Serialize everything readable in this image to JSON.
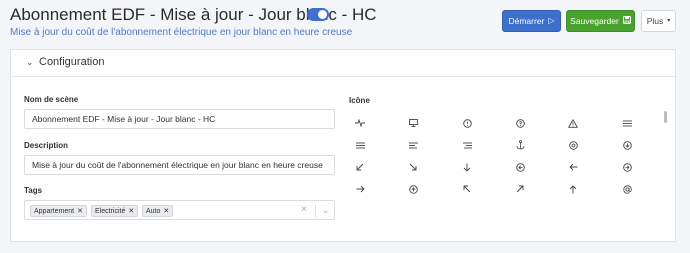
{
  "header": {
    "title": "Abonnement EDF - Mise à jour - Jour blanc - HC",
    "subtitle": "Mise à jour du coût de l'abonnement électrique en jour blanc en heure creuse",
    "toggle_on": true,
    "start_label": "Démarrer",
    "save_label": "Sauvegarder",
    "more_label": "Plus"
  },
  "colors": {
    "primary": "#3d6fcd",
    "success": "#4aa22e",
    "subtitle": "#4f7cc8"
  },
  "card": {
    "title": "Configuration",
    "name_label": "Nom de scène",
    "name_value": "Abonnement EDF - Mise à jour - Jour blanc - HC",
    "description_label": "Description",
    "description_value": "Mise à jour du coût de l'abonnement électrique en jour blanc en heure creuse",
    "tags_label": "Tags",
    "tags": [
      "Appartement",
      "Electricité",
      "Auto"
    ],
    "icons_label": "Icône"
  },
  "icons": [
    [
      "activity",
      "monitor",
      "alert-circle",
      "help-circle",
      "alert-triangle",
      "align-justify"
    ],
    [
      "align-justify",
      "align-left",
      "align-right",
      "anchor",
      "aperture",
      "arrow-down-circle"
    ],
    [
      "arrow-down-left",
      "arrow-down-right",
      "arrow-down",
      "arrow-left-circle",
      "arrow-left",
      "arrow-right-circle"
    ],
    [
      "arrow-right",
      "arrow-up-circle",
      "arrow-up-left",
      "arrow-up-right",
      "arrow-up",
      "at-sign"
    ]
  ]
}
